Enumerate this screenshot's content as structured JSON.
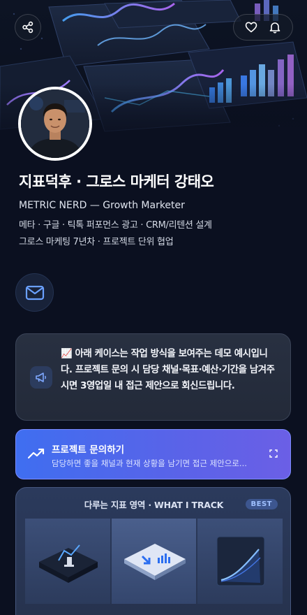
{
  "profile": {
    "name": "지표덕후 · 그로스 마케터 강태오",
    "subtitle": "METRIC NERD — Growth Marketer",
    "desc_line1": "메타 · 구글 · 틱톡 퍼포먼스 광고 · CRM/리텐션 설계",
    "desc_line2": "그로스 마케팅 7년차 · 프로젝트 단위 협업"
  },
  "header": {
    "share_icon": "share-icon",
    "heart_icon": "heart-icon",
    "bell_icon": "bell-icon"
  },
  "contact": {
    "mail_icon": "mail-icon"
  },
  "notice": {
    "emoji": "📈",
    "text": "아래 케이스는 작업 방식을 보여주는 데모 예시입니다. 프로젝트 문의 시 담당 채널·목표·예산·기간을 남겨주시면 3영업일 내 접근 제안으로 회신드립니다."
  },
  "cta": {
    "title": "프로젝트 문의하기",
    "subtitle": "담당하면 좋을 채널과 현재 상황을 남기면 접근 제안으로..."
  },
  "track": {
    "title": "다루는 지표 영역 · WHAT I TRACK",
    "badge": "BEST"
  },
  "colors": {
    "background": "#0b1020",
    "accent": "#4f6ef0",
    "card": "#283041"
  }
}
